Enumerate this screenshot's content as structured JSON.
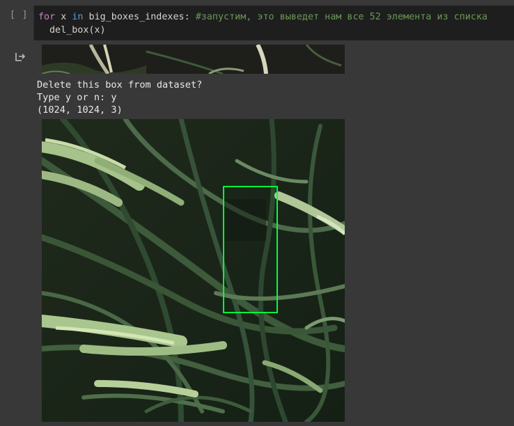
{
  "cell": {
    "run_label": "[ ]",
    "code": {
      "kw_for": "for",
      "var_x": " x ",
      "kw_in": "in",
      "iter": " big_boxes_indexes:",
      "comment": " #запустим, это выведет нам все 52 элемента из списка",
      "line2": "del_box(x)"
    }
  },
  "output": {
    "icon": "output-arrow-icon",
    "lines": [
      "Delete this box from dataset?",
      "Type y or n: y",
      "(1024, 1024, 3)"
    ]
  },
  "colors": {
    "background": "#383838",
    "editor": "#1e1e1e",
    "bbox": "#00ff3c"
  }
}
